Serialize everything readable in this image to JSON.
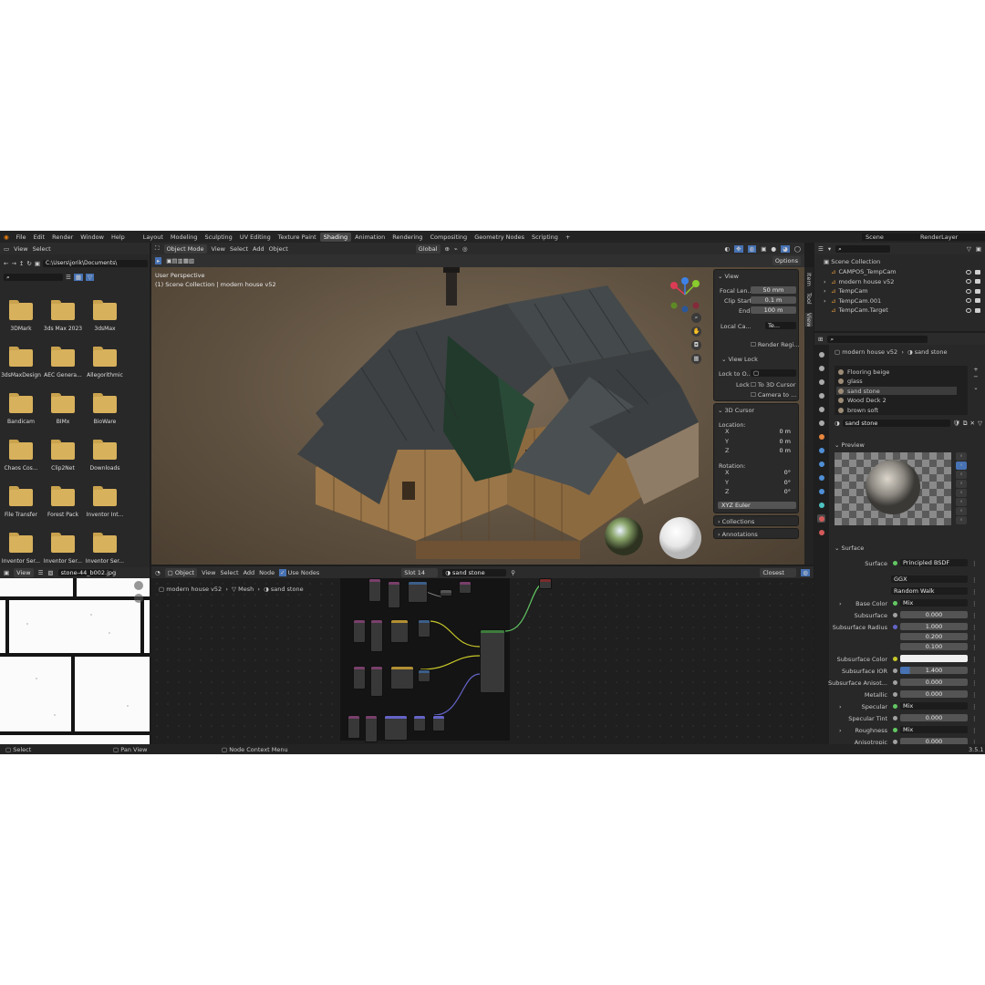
{
  "topbar": {
    "menus": [
      "File",
      "Edit",
      "Render",
      "Window",
      "Help"
    ],
    "workspaces": [
      "Layout",
      "Modeling",
      "Sculpting",
      "UV Editing",
      "Texture Paint",
      "Shading",
      "Animation",
      "Rendering",
      "Compositing",
      "Geometry Nodes",
      "Scripting",
      "+"
    ],
    "scene": "Scene",
    "view_layer": "RenderLayer"
  },
  "file_browser": {
    "menus": [
      "View",
      "Select"
    ],
    "path": "C:\\Users\\jorik\\Documents\\",
    "folders": [
      "3DMark",
      "3ds Max 2023",
      "3dsMax",
      "3dsMaxDesign",
      "AEC Genera...",
      "Allegorithmic",
      "Bandicam",
      "BIMx",
      "BioWare",
      "Chaos Cos...",
      "Clip2Net",
      "Downloads",
      "File Transfer",
      "Forest Pack",
      "Inventor Int...",
      "Inventor Ser...",
      "Inventor Ser...",
      "Inventor Ser..."
    ]
  },
  "image_editor": {
    "view": "View",
    "image": "stone-44_b002.jpg"
  },
  "viewport": {
    "mode": "Object Mode",
    "menus": [
      "View",
      "Select",
      "Add",
      "Object"
    ],
    "transform": "Global",
    "options": "Options",
    "overlay_title": "User Perspective",
    "overlay_sub": "(1) Scene Collection | modern house v52",
    "tabs": [
      "Item",
      "Tool",
      "View"
    ]
  },
  "npanel": {
    "view_header": "View",
    "focal_label": "Focal Len...",
    "focal_value": "50 mm",
    "clip_start_label": "Clip Start",
    "clip_start_value": "0.1 m",
    "end_label": "End",
    "end_value": "100 m",
    "local_cam_label": "Local Ca...",
    "local_cam_value": "Te...",
    "render_region": "Render Regi...",
    "view_lock_header": "View Lock",
    "lock_to_label": "Lock to O...",
    "lock_label": "Lock",
    "to_3d_cursor": "To 3D Cursor",
    "camera_to": "Camera to ...",
    "cursor_header": "3D Cursor",
    "location_label": "Location:",
    "loc": [
      {
        "axis": "X",
        "value": "0 m"
      },
      {
        "axis": "Y",
        "value": "0 m"
      },
      {
        "axis": "Z",
        "value": "0 m"
      }
    ],
    "rotation_label": "Rotation:",
    "rot": [
      {
        "axis": "X",
        "value": "0°"
      },
      {
        "axis": "Y",
        "value": "0°"
      },
      {
        "axis": "Z",
        "value": "0°"
      }
    ],
    "rot_mode": "XYZ Euler",
    "collections": "Collections",
    "annotations": "Annotations"
  },
  "node_editor": {
    "object": "Object",
    "menus": [
      "View",
      "Select",
      "Add",
      "Node"
    ],
    "use_nodes": "Use Nodes",
    "slot": "Slot 14",
    "material": "sand stone",
    "breadcrumb": [
      "modern house v52",
      "Mesh",
      "sand stone"
    ],
    "interp": "Closest"
  },
  "outliner": {
    "root": "Scene Collection",
    "items": [
      "CAMPOS_TempCam",
      "modern house v52",
      "TempCam",
      "TempCam.001",
      "TempCam.Target"
    ]
  },
  "properties": {
    "breadcrumb": [
      "modern house v52",
      "sand stone"
    ],
    "materials": [
      "Flooring beige",
      "glass",
      "sand stone",
      "Wood Deck 2",
      "brown soft"
    ],
    "active_material": "sand stone",
    "preview_header": "Preview",
    "surface_header": "Surface",
    "surface_label": "Surface",
    "surface_value": "Principled BSDF",
    "distribution": "GGX",
    "subsurface_method": "Random Walk",
    "base_color_label": "Base Color",
    "base_color_value": "Mix",
    "subsurface_label": "Subsurface",
    "subsurface_value": "0.000",
    "subsurface_radius_label": "Subsurface Radius",
    "radius": [
      "1.000",
      "0.200",
      "0.100"
    ],
    "ss_color_label": "Subsurface Color",
    "ss_ior_label": "Subsurface IOR",
    "ss_ior_value": "1.400",
    "ss_aniso_label": "Subsurface Anisot...",
    "ss_aniso_value": "0.000",
    "metallic_label": "Metallic",
    "metallic_value": "0.000",
    "specular_label": "Specular",
    "specular_value": "Mix",
    "specular_tint_label": "Specular Tint",
    "specular_tint_value": "0.000",
    "roughness_label": "Roughness",
    "roughness_value": "Mix",
    "anisotropic_label": "Anisotropic",
    "anisotropic_value": "0.000"
  },
  "statusbar": {
    "select": "Select",
    "pan": "Pan View",
    "context": "Node Context Menu",
    "version": "3.5.1"
  }
}
